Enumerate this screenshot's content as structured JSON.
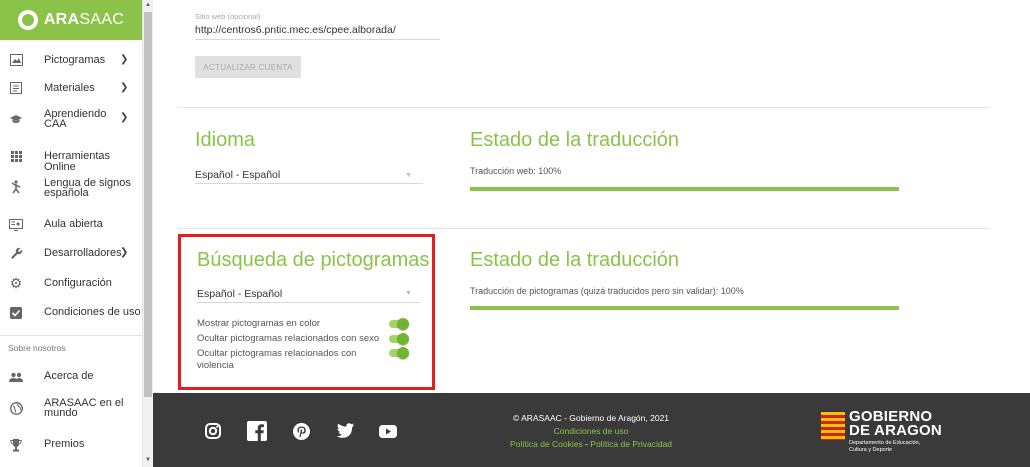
{
  "brand": {
    "name_bold": "ARA",
    "name_rest": "SAAC"
  },
  "sidebar": {
    "items": [
      {
        "label": "Pictogramas",
        "icon": "image-icon",
        "chevron": true
      },
      {
        "label": "Materiales",
        "icon": "book-icon",
        "chevron": true
      },
      {
        "label": "Aprendiendo\nCAA",
        "icon": "graduation-cap-icon",
        "chevron": true
      },
      {
        "label": "Herramientas Online",
        "icon": "grid-icon",
        "chevron": false
      },
      {
        "label": "Lengua de signos\nespañola",
        "icon": "sign-language-icon",
        "chevron": false
      },
      {
        "label": "Aula abierta",
        "icon": "classroom-icon",
        "chevron": false
      },
      {
        "label": "Desarrolladores",
        "icon": "wrench-icon",
        "chevron": true
      },
      {
        "label": "Configuración",
        "icon": "gear-icon",
        "chevron": false
      },
      {
        "label": "Condiciones de uso",
        "icon": "checkbox-icon",
        "chevron": false
      }
    ],
    "section_label": "Sobre nosotros",
    "about_items": [
      {
        "label": "Acerca de",
        "icon": "people-icon"
      },
      {
        "label": "ARASAAC en el\nmundo",
        "icon": "globe-icon"
      },
      {
        "label": "Premios",
        "icon": "trophy-icon"
      }
    ]
  },
  "account": {
    "website_label": "Sitio web (opcional)",
    "website_value": "http://centros6.pntic.mec.es/cpee.alborada/",
    "update_button": "ACTUALIZAR CUENTA"
  },
  "language": {
    "title": "Idioma",
    "selected": "Español - Español",
    "status_title": "Estado de la traducción",
    "status_label": "Traducción web: 100%",
    "progress_fraction": 1.0
  },
  "pictogram_search": {
    "title": "Búsqueda de pictogramas",
    "selected": "Español - Español",
    "toggles": [
      {
        "label": "Mostrar pictogramas en color",
        "on": true
      },
      {
        "label": "Ocultar pictogramas relacionados con sexo",
        "on": true
      },
      {
        "label": "Ocultar pictogramas relacionados con\nviolencia",
        "on": true
      }
    ],
    "status_title": "Estado de la traducción",
    "status_label": "Traducción de pictogramas (quizá traducidos pero sin validar): 100%",
    "progress_fraction": 1.0
  },
  "footer": {
    "copyright": "© ARASAAC - Gobierno de Aragón, 2021",
    "terms_link": "Condiciones de uso",
    "cookies_link": "Política de Cookies",
    "separator": " - ",
    "privacy_link": "Política de Privacidad",
    "social": [
      "instagram-icon",
      "facebook-icon",
      "pinterest-icon",
      "twitter-icon",
      "youtube-icon"
    ],
    "gov_line1": "GOBIERNO",
    "gov_line2": "DE ARAGON",
    "gov_sub1": "Departamento de Educación,",
    "gov_sub2": "Cultura y Deporte"
  },
  "colors": {
    "accent": "#8bc34a",
    "highlight": "#e02020",
    "footer_bg": "#3a3a3a"
  }
}
